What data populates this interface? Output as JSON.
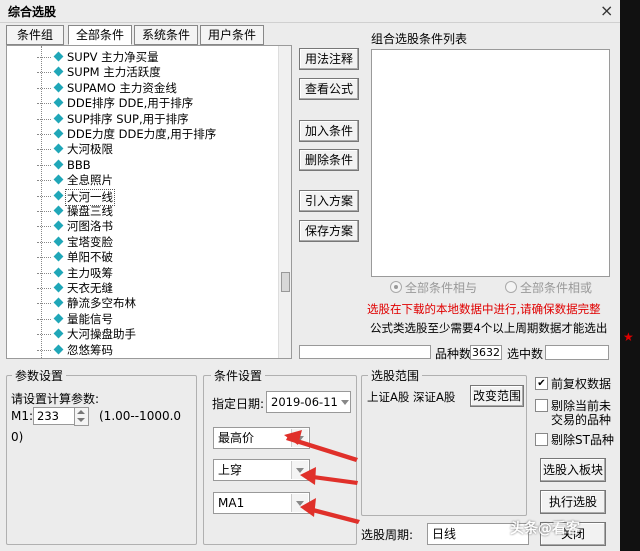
{
  "window": {
    "title": "综合选股",
    "close": "×"
  },
  "tabs": [
    "条件组",
    "全部条件",
    "系统条件",
    "用户条件"
  ],
  "list_items": [
    "SUPV 主力净买量",
    "SUPM 主力活跃度",
    "SUPAMO 主力资金线",
    "DDE排序 DDE,用于排序",
    "SUP排序 SUP,用于排序",
    "DDE力度 DDE力度,用于排序",
    "大河极限",
    "BBB",
    "全息照片",
    "大河一线",
    "操盘三线",
    "河图洛书",
    "宝塔变脸",
    "单阳不破",
    "主力吸筹",
    "天衣无缝",
    "静流多空布林",
    "量能信号",
    "大河操盘助手",
    "忽悠筹码"
  ],
  "selected_item": "大河一线",
  "buttons": {
    "usage": "用法注释",
    "formula": "查看公式",
    "add": "加入条件",
    "delete": "删除条件",
    "import": "引入方案",
    "save": "保存方案",
    "change_range": "改变范围",
    "to_block": "选股入板块",
    "execute": "执行选股",
    "close": "关闭"
  },
  "combo": {
    "title": "组合选股条件列表",
    "radio_all_and": "全部条件相与",
    "radio_all_or": "全部条件相或",
    "notice_red": "选股在下载的本地数据中进行,请确保数据完整",
    "notice_black": "公式类选股至少需要4个以上周期数据才能选出",
    "count_label": "品种数",
    "count_value": "3632",
    "selected_label": "选中数",
    "selected_value": ""
  },
  "params": {
    "group_title": "参数设置",
    "prompt": "请设置计算参数:",
    "m1_label": "M1:",
    "m1_value": "233",
    "range": "(1.00--1000.0",
    "range_end": "0)"
  },
  "conditions": {
    "group_title": "条件设置",
    "date_label": "指定日期:",
    "date_value": "2019-06-11",
    "field1": "最高价",
    "field2": "上穿",
    "field3": "MA1"
  },
  "scope": {
    "group_title": "选股范围",
    "value": "上证A股 深证A股",
    "period_label": "选股周期:",
    "period_value": "日线"
  },
  "options": {
    "fq": "前复权数据",
    "exclude_suspended_1": "剔除当前未",
    "exclude_suspended_2": "交易的品种",
    "exclude_st": "剔除ST品种",
    "fq_checked": "✔"
  },
  "watermark": "头条@看客",
  "colors": {
    "arrow": "#e0302a",
    "accent": "#20a7b8"
  }
}
